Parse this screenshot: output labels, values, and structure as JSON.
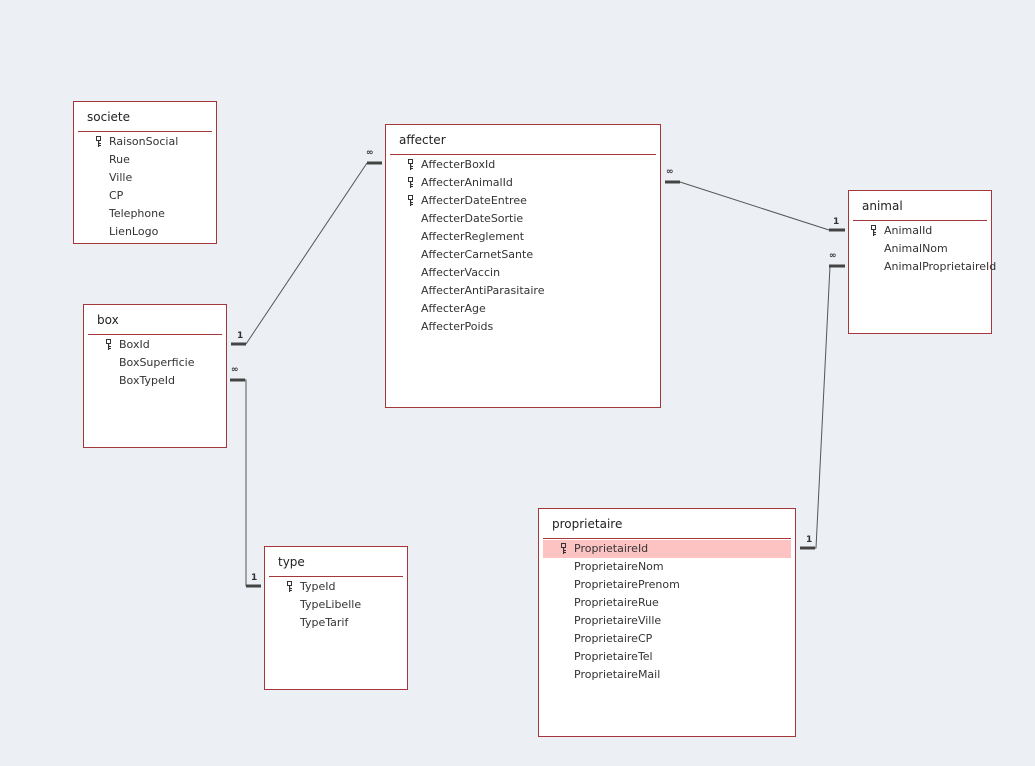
{
  "colors": {
    "table_border": "#a4373a",
    "selected_row": "#fdc3c3",
    "line": "#555555"
  },
  "tables": [
    {
      "id": "societe",
      "name": "societe",
      "fields": [
        {
          "name": "RaisonSocial",
          "key": true
        },
        {
          "name": "Rue"
        },
        {
          "name": "Ville"
        },
        {
          "name": "CP"
        },
        {
          "name": "Telephone"
        },
        {
          "name": "LienLogo"
        }
      ]
    },
    {
      "id": "affecter",
      "name": "affecter",
      "fields": [
        {
          "name": "AffecterBoxId",
          "key": true
        },
        {
          "name": "AffecterAnimalId",
          "key": true
        },
        {
          "name": "AffecterDateEntree",
          "key": true
        },
        {
          "name": "AffecterDateSortie"
        },
        {
          "name": "AffecterReglement"
        },
        {
          "name": "AffecterCarnetSante"
        },
        {
          "name": "AffecterVaccin"
        },
        {
          "name": "AffecterAntiParasitaire"
        },
        {
          "name": "AffecterAge"
        },
        {
          "name": "AffecterPoids"
        }
      ]
    },
    {
      "id": "animal",
      "name": "animal",
      "fields": [
        {
          "name": "AnimalId",
          "key": true
        },
        {
          "name": "AnimalNom"
        },
        {
          "name": "AnimalProprietaireId"
        }
      ]
    },
    {
      "id": "box",
      "name": "box",
      "fields": [
        {
          "name": "BoxId",
          "key": true
        },
        {
          "name": "BoxSuperficie"
        },
        {
          "name": "BoxTypeId"
        }
      ]
    },
    {
      "id": "type",
      "name": "type",
      "fields": [
        {
          "name": "TypeId",
          "key": true
        },
        {
          "name": "TypeLibelle"
        },
        {
          "name": "TypeTarif"
        }
      ]
    },
    {
      "id": "proprietaire",
      "name": "proprietaire",
      "fields": [
        {
          "name": "ProprietaireId",
          "key": true,
          "selected": true
        },
        {
          "name": "ProprietaireNom"
        },
        {
          "name": "ProprietairePrenom"
        },
        {
          "name": "ProprietaireRue"
        },
        {
          "name": "ProprietaireVille"
        },
        {
          "name": "ProprietaireCP"
        },
        {
          "name": "ProprietaireTel"
        },
        {
          "name": "ProprietaireMail"
        }
      ]
    }
  ],
  "relationships": [
    {
      "one": "box.BoxId",
      "many": "affecter.AffecterBoxId",
      "one_label": "1",
      "many_label": "∞"
    },
    {
      "one": "animal.AnimalId",
      "many": "affecter.AffecterAnimalId",
      "one_label": "1",
      "many_label": "∞"
    },
    {
      "one": "type.TypeId",
      "many": "box.BoxTypeId",
      "one_label": "1",
      "many_label": "∞"
    },
    {
      "one": "proprietaire.ProprietaireId",
      "many": "animal.AnimalProprietaireId",
      "one_label": "1",
      "many_label": "∞"
    }
  ]
}
